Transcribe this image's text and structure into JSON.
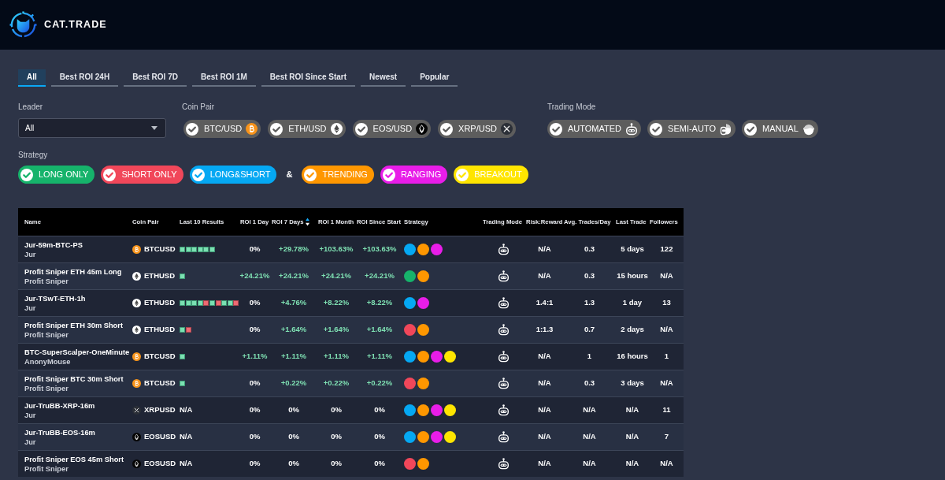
{
  "header": {
    "brand": "CAT.TRADE"
  },
  "tabs": [
    {
      "label": "All",
      "selected": true
    },
    {
      "label": "Best ROI 24H",
      "selected": false
    },
    {
      "label": "Best ROI 7D",
      "selected": false
    },
    {
      "label": "Best ROI 1M",
      "selected": false
    },
    {
      "label": "Best ROI Since Start",
      "selected": false
    },
    {
      "label": "Newest",
      "selected": false
    },
    {
      "label": "Popular",
      "selected": false
    }
  ],
  "filters": {
    "leader": {
      "label": "Leader",
      "value": "All"
    },
    "coin_pair": {
      "label": "Coin Pair",
      "items": [
        {
          "label": "BTC/USD",
          "kind": "btc",
          "checked": true
        },
        {
          "label": "ETH/USD",
          "kind": "eth",
          "checked": true
        },
        {
          "label": "EOS/USD",
          "kind": "eos",
          "checked": true
        },
        {
          "label": "XRP/USD",
          "kind": "xrp",
          "checked": true
        }
      ]
    },
    "trading_mode": {
      "label": "Trading Mode",
      "items": [
        {
          "label": "AUTOMATED",
          "kind": "robot",
          "checked": true
        },
        {
          "label": "SEMI-AUTO",
          "kind": "hybrid",
          "checked": true
        },
        {
          "label": "MANUAL",
          "kind": "person",
          "checked": true
        }
      ]
    },
    "strategy": {
      "label": "Strategy",
      "joiner": "&",
      "groups": [
        {
          "items": [
            {
              "label": "LONG ONLY",
              "color": "#16b36b",
              "checked": true
            },
            {
              "label": "SHORT ONLY",
              "color": "#f1475a",
              "checked": true
            },
            {
              "label": "LONG&SHORT",
              "color": "#05a8f3",
              "checked": true
            }
          ]
        },
        {
          "items": [
            {
              "label": "TRENDING",
              "color": "#ff9700",
              "checked": true
            },
            {
              "label": "RANGING",
              "color": "#e81de8",
              "checked": true
            },
            {
              "label": "BREAKOUT",
              "color": "#ffe500",
              "checked": true
            }
          ]
        }
      ]
    }
  },
  "table": {
    "columns": [
      {
        "label": "Name",
        "sorted": false
      },
      {
        "label": "Coin Pair",
        "sorted": false
      },
      {
        "label": "Last 10 Results",
        "sorted": false
      },
      {
        "label": "ROI 1 Day",
        "sorted": false
      },
      {
        "label": "ROI 7 Days",
        "sorted": true
      },
      {
        "label": "ROI 1 Month",
        "sorted": false
      },
      {
        "label": "ROI Since Start",
        "sorted": false
      },
      {
        "label": "Strategy",
        "sorted": false
      },
      {
        "label": "Trading Mode",
        "sorted": false
      },
      {
        "label": "Risk:Reward",
        "sorted": false
      },
      {
        "label": "Avg. Trades/Day",
        "sorted": false
      },
      {
        "label": "Last Trade",
        "sorted": false
      },
      {
        "label": "Followers",
        "sorted": false
      }
    ],
    "rows": [
      {
        "name": "Jur-59m-BTC-PS",
        "leader": "Jur",
        "coin": {
          "kind": "btc",
          "label": "BTCUSD"
        },
        "last_results": [
          {
            "win": true
          },
          {
            "win": true
          },
          {
            "win": true
          },
          {
            "win": true
          },
          {
            "win": true
          },
          {
            "win": true
          }
        ],
        "roi": [
          {
            "text": "0%",
            "positive": false
          },
          {
            "text": "+29.78%",
            "positive": true
          },
          {
            "text": "+103.63%",
            "positive": true
          },
          {
            "text": "+103.63%",
            "positive": true
          }
        ],
        "strategies": [
          {
            "color": "#05a8f3"
          },
          {
            "color": "#ff9700"
          },
          {
            "color": "#e81de8"
          }
        ],
        "trading_mode": {
          "kind": "robot"
        },
        "risk_reward": "N/A",
        "avg_trades_per_day": "0.3",
        "last_trade": "5 days",
        "followers": "122"
      },
      {
        "name": "Profit Sniper ETH 45m Long",
        "leader": "Profit Sniper",
        "coin": {
          "kind": "eth",
          "label": "ETHUSD"
        },
        "last_results": [
          {
            "win": true
          }
        ],
        "roi": [
          {
            "text": "+24.21%",
            "positive": true
          },
          {
            "text": "+24.21%",
            "positive": true
          },
          {
            "text": "+24.21%",
            "positive": true
          },
          {
            "text": "+24.21%",
            "positive": true
          }
        ],
        "strategies": [
          {
            "color": "#16b36b"
          },
          {
            "color": "#ff9700"
          }
        ],
        "trading_mode": {
          "kind": "robot"
        },
        "risk_reward": "N/A",
        "avg_trades_per_day": "0.3",
        "last_trade": "15 hours",
        "followers": "N/A"
      },
      {
        "name": "Jur-TSwT-ETH-1h",
        "leader": "Jur",
        "coin": {
          "kind": "eth",
          "label": "ETHUSD"
        },
        "last_results": [
          {
            "win": true
          },
          {
            "win": true
          },
          {
            "win": true
          },
          {
            "win": true
          },
          {
            "win": false
          },
          {
            "win": true
          },
          {
            "win": false
          },
          {
            "win": true
          },
          {
            "win": true
          },
          {
            "win": false
          }
        ],
        "roi": [
          {
            "text": "0%",
            "positive": false
          },
          {
            "text": "+4.76%",
            "positive": true
          },
          {
            "text": "+8.22%",
            "positive": true
          },
          {
            "text": "+8.22%",
            "positive": true
          }
        ],
        "strategies": [
          {
            "color": "#05a8f3"
          },
          {
            "color": "#e81de8"
          }
        ],
        "trading_mode": {
          "kind": "robot"
        },
        "risk_reward": "1.4:1",
        "avg_trades_per_day": "1.3",
        "last_trade": "1 day",
        "followers": "13"
      },
      {
        "name": "Profit Sniper ETH 30m Short",
        "leader": "Profit Sniper",
        "coin": {
          "kind": "eth",
          "label": "ETHUSD"
        },
        "last_results": [
          {
            "win": true
          },
          {
            "win": false
          }
        ],
        "roi": [
          {
            "text": "0%",
            "positive": false
          },
          {
            "text": "+1.64%",
            "positive": true
          },
          {
            "text": "+1.64%",
            "positive": true
          },
          {
            "text": "+1.64%",
            "positive": true
          }
        ],
        "strategies": [
          {
            "color": "#f1475a"
          },
          {
            "color": "#ff9700"
          }
        ],
        "trading_mode": {
          "kind": "robot"
        },
        "risk_reward": "1:1.3",
        "avg_trades_per_day": "0.7",
        "last_trade": "2 days",
        "followers": "N/A"
      },
      {
        "name": "BTC-SuperScalper-OneMinute",
        "leader": "AnonyMouse",
        "coin": {
          "kind": "btc",
          "label": "BTCUSD"
        },
        "last_results": [
          {
            "win": true
          }
        ],
        "roi": [
          {
            "text": "+1.11%",
            "positive": true
          },
          {
            "text": "+1.11%",
            "positive": true
          },
          {
            "text": "+1.11%",
            "positive": true
          },
          {
            "text": "+1.11%",
            "positive": true
          }
        ],
        "strategies": [
          {
            "color": "#05a8f3"
          },
          {
            "color": "#ff9700"
          },
          {
            "color": "#e81de8"
          },
          {
            "color": "#ffe500"
          }
        ],
        "trading_mode": {
          "kind": "robot"
        },
        "risk_reward": "N/A",
        "avg_trades_per_day": "1",
        "last_trade": "16 hours",
        "followers": "1"
      },
      {
        "name": "Profit Sniper BTC 30m Short",
        "leader": "Profit Sniper",
        "coin": {
          "kind": "btc",
          "label": "BTCUSD"
        },
        "last_results": [
          {
            "win": true
          }
        ],
        "roi": [
          {
            "text": "0%",
            "positive": false
          },
          {
            "text": "+0.22%",
            "positive": true
          },
          {
            "text": "+0.22%",
            "positive": true
          },
          {
            "text": "+0.22%",
            "positive": true
          }
        ],
        "strategies": [
          {
            "color": "#f1475a"
          },
          {
            "color": "#ff9700"
          }
        ],
        "trading_mode": {
          "kind": "robot"
        },
        "risk_reward": "N/A",
        "avg_trades_per_day": "0.3",
        "last_trade": "3 days",
        "followers": "N/A"
      },
      {
        "name": "Jur-TruBB-XRP-16m",
        "leader": "Jur",
        "coin": {
          "kind": "xrp",
          "label": "XRPUSD"
        },
        "last_results_text": "N/A",
        "roi": [
          {
            "text": "0%",
            "positive": false
          },
          {
            "text": "0%",
            "positive": false
          },
          {
            "text": "0%",
            "positive": false
          },
          {
            "text": "0%",
            "positive": false
          }
        ],
        "strategies": [
          {
            "color": "#05a8f3"
          },
          {
            "color": "#ff9700"
          },
          {
            "color": "#e81de8"
          },
          {
            "color": "#ffe500"
          }
        ],
        "trading_mode": {
          "kind": "robot"
        },
        "risk_reward": "N/A",
        "avg_trades_per_day": "N/A",
        "last_trade": "N/A",
        "followers": "11"
      },
      {
        "name": "Jur-TruBB-EOS-16m",
        "leader": "Jur",
        "coin": {
          "kind": "eos",
          "label": "EOSUSD"
        },
        "last_results_text": "N/A",
        "roi": [
          {
            "text": "0%",
            "positive": false
          },
          {
            "text": "0%",
            "positive": false
          },
          {
            "text": "0%",
            "positive": false
          },
          {
            "text": "0%",
            "positive": false
          }
        ],
        "strategies": [
          {
            "color": "#05a8f3"
          },
          {
            "color": "#ff9700"
          },
          {
            "color": "#e81de8"
          },
          {
            "color": "#ffe500"
          }
        ],
        "trading_mode": {
          "kind": "robot"
        },
        "risk_reward": "N/A",
        "avg_trades_per_day": "N/A",
        "last_trade": "N/A",
        "followers": "7"
      },
      {
        "name": "Profit Sniper EOS 45m Short",
        "leader": "Profit Sniper",
        "coin": {
          "kind": "eos",
          "label": "EOSUSD"
        },
        "last_results_text": "N/A",
        "roi": [
          {
            "text": "0%",
            "positive": false
          },
          {
            "text": "0%",
            "positive": false
          },
          {
            "text": "0%",
            "positive": false
          },
          {
            "text": "0%",
            "positive": false
          }
        ],
        "strategies": [
          {
            "color": "#f1475a"
          },
          {
            "color": "#ff9700"
          }
        ],
        "trading_mode": {
          "kind": "robot"
        },
        "risk_reward": "N/A",
        "avg_trades_per_day": "N/A",
        "last_trade": "N/A",
        "followers": "N/A"
      }
    ]
  }
}
